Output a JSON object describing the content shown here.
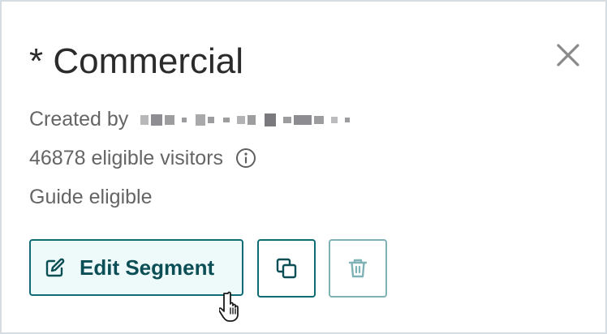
{
  "segment": {
    "title": "* Commercial",
    "created_by_label": "Created by",
    "visitors_text": "46878 eligible visitors",
    "guide_text": "Guide eligible"
  },
  "actions": {
    "edit_label": "Edit Segment"
  },
  "icons": {
    "close": "close-icon",
    "info": "info-icon",
    "edit": "edit-icon",
    "copy": "copy-icon",
    "delete": "trash-icon",
    "cursor": "hand-pointer-icon"
  },
  "colors": {
    "primary": "#0f6b74",
    "primary_text": "#0b4e55",
    "primary_bg": "#eefafa",
    "disabled_border": "#7fb2b6",
    "muted_text": "#656565",
    "border": "#d5dde3"
  }
}
